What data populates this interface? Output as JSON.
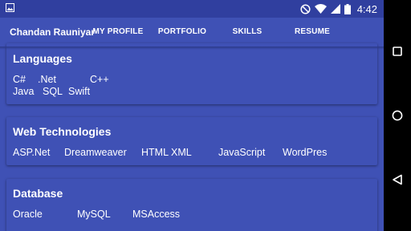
{
  "status_bar": {
    "time": "4:42",
    "icons": [
      "image-icon",
      "do-not-disturb-icon",
      "wifi-icon",
      "cellular-icon",
      "battery-icon"
    ]
  },
  "app_bar": {
    "title": "Chandan Rauniyar",
    "tabs": [
      {
        "label": "MY PROFILE",
        "selected": false
      },
      {
        "label": "PORTFOLIO",
        "selected": false
      },
      {
        "label": "SKILLS",
        "selected": true
      },
      {
        "label": "RESUME",
        "selected": false
      }
    ],
    "indicator_color": "#ff4081"
  },
  "cards": {
    "languages": {
      "title": "Languages",
      "row1": [
        "C#",
        ".Net",
        "C++"
      ],
      "row2": [
        "Java",
        "SQL",
        "Swift"
      ]
    },
    "web": {
      "title": "Web Technologies",
      "items": [
        "ASP.Net",
        "Dreamweaver",
        "HTML XML",
        "JavaScript",
        "WordPres"
      ]
    },
    "database": {
      "title": "Database",
      "items": [
        "Oracle",
        "MySQL",
        "MSAccess"
      ]
    }
  },
  "nav_bar": {
    "icons": [
      "recents-icon",
      "home-icon",
      "back-icon"
    ]
  },
  "colors": {
    "primary": "#3f51b5",
    "primary_dark": "#303f9f",
    "accent": "#ff4081"
  }
}
